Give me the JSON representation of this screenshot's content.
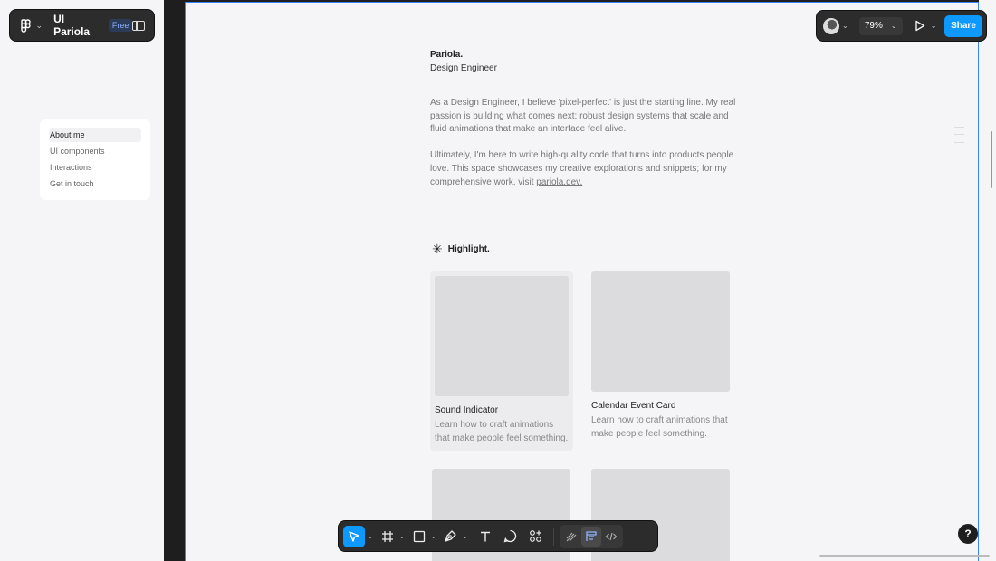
{
  "file": {
    "name": "UI Pariola",
    "plan_badge": "Free"
  },
  "left_nav": {
    "items": [
      {
        "label": "About me",
        "active": true
      },
      {
        "label": "UI components",
        "active": false
      },
      {
        "label": "Interactions",
        "active": false
      },
      {
        "label": "Get in touch",
        "active": false
      }
    ]
  },
  "header_right": {
    "zoom": "79%",
    "share_label": "Share"
  },
  "profile": {
    "name": "Pariola.",
    "role": "Design Engineer",
    "paragraph1": "As a Design Engineer, I believe 'pixel-perfect' is just the starting line. My real passion is building what comes next: robust design systems that scale and fluid animations that make an interface feel alive.",
    "paragraph2_pre": "Ultimately, I'm here to write high-quality code that turns into products people love. This space showcases my creative explorations and snippets; for my comprehensive work, visit ",
    "paragraph2_link": "pariola.dev."
  },
  "highlight": {
    "title": "Highlight."
  },
  "cards": [
    {
      "title": "Sound Indicator",
      "description": "Learn how to craft animations that make people feel something."
    },
    {
      "title": "Calendar Event Card",
      "description": "Learn how to craft animations that make people feel something."
    }
  ],
  "help_label": "?",
  "colors": {
    "accent": "#0d99ff",
    "frame_border": "#3b82f6",
    "toolbar_bg": "#2c2c2c"
  },
  "icons": {
    "file_menu": "figma-logo-icon",
    "panel": "sidebar-toggle-icon",
    "move": "cursor-arrow-icon",
    "frame": "frame-hash-icon",
    "rect": "rectangle-icon",
    "pen": "pen-icon",
    "text": "text-icon",
    "comment": "comment-icon",
    "actions": "actions-icon",
    "draw": "draw-icon",
    "design": "design-mode-icon",
    "dev": "code-icon",
    "present": "play-icon"
  }
}
